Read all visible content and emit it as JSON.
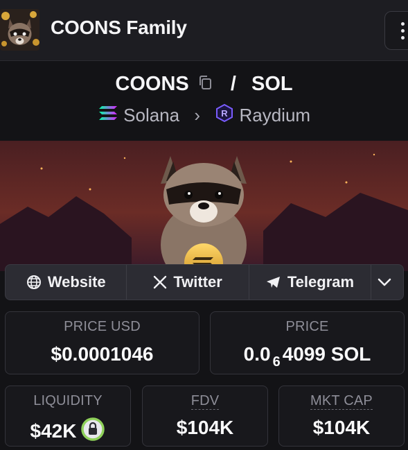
{
  "header": {
    "token_name": "COONS Family",
    "avatar_icon": "raccoon-avatar",
    "menu_icon": "vertical-dots-icon"
  },
  "pair": {
    "base": "COONS",
    "separator": "/",
    "quote": "SOL",
    "copy_icon": "copy-icon"
  },
  "chain": {
    "network": "Solana",
    "network_icon": "solana-logo-icon",
    "dex": "Raydium",
    "dex_icon": "raydium-logo-icon"
  },
  "links": {
    "website": "Website",
    "twitter": "Twitter",
    "telegram": "Telegram"
  },
  "stats": {
    "price_usd_label": "PRICE USD",
    "price_usd_value": "$0.0001046",
    "price_label": "PRICE",
    "price_sol_prefix": "0.0",
    "price_sol_zeros": "6",
    "price_sol_digits": "4099",
    "price_sol_unit": "SOL",
    "liquidity_label": "LIQUIDITY",
    "liquidity_value": "$42K",
    "fdv_label": "FDV",
    "fdv_value": "$104K",
    "mktcap_label": "MKT CAP",
    "mktcap_value": "$104K"
  },
  "colors": {
    "background": "#131316",
    "header_bg": "#1d1d22",
    "lock_ring": "#8fd15a",
    "label": "#8e8e98"
  }
}
